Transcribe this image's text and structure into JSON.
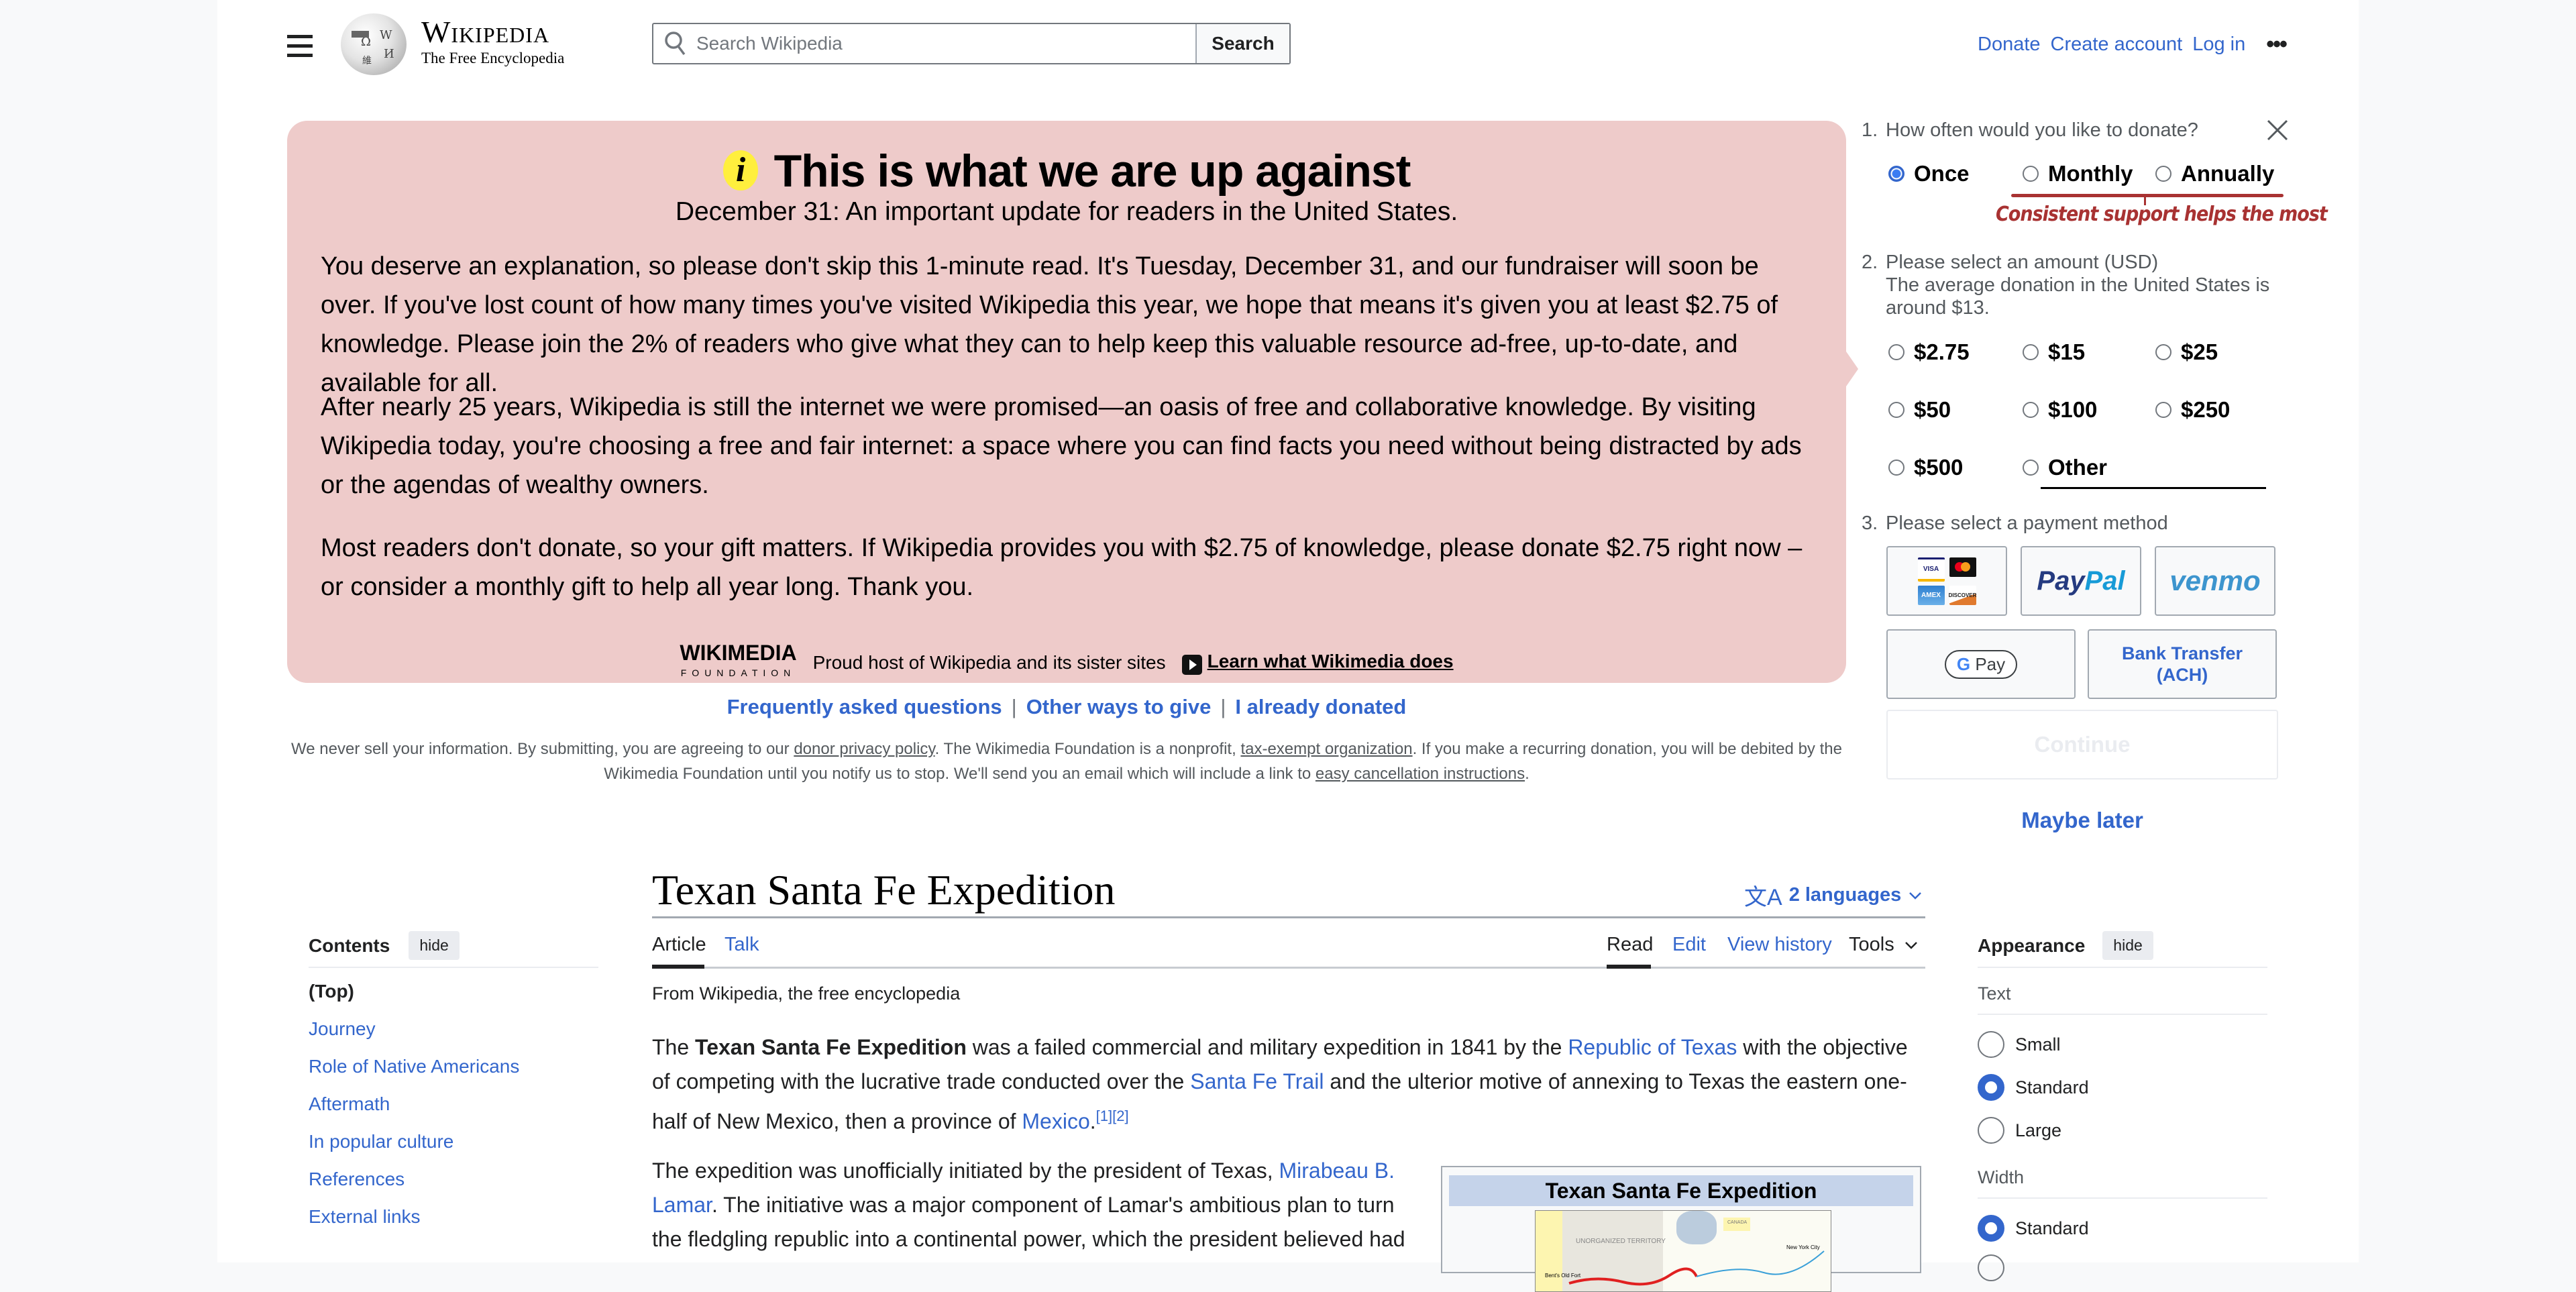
{
  "header": {
    "logo_wordmark": "Wikipedia",
    "logo_tagline": "The Free Encyclopedia",
    "search_placeholder": "Search Wikipedia",
    "search_button": "Search",
    "links": [
      "Donate",
      "Create account",
      "Log in"
    ],
    "more_icon": "ellipsis-icon"
  },
  "banner": {
    "title": "This is what we are up against",
    "subtitle": "December 31: An important update for readers in the United States.",
    "paragraphs": [
      "You deserve an explanation, so please don't skip this 1-minute read. It's Tuesday, December 31, and our fundraiser will soon be over. If you've lost count of how many times you've visited Wikipedia this year, we hope that means it's given you at least $2.75 of knowledge. Please join the 2% of readers who give what they can to help keep this valuable resource ad-free, up-to-date, and available for all.",
      "After nearly 25 years, Wikipedia is still the internet we were promised—an oasis of free and collaborative knowledge. By visiting Wikipedia today, you're choosing a free and fair internet: a space where you can find facts you need without being distracted by ads or the agendas of wealthy owners.",
      "Most readers don't donate, so your gift matters. If Wikipedia provides you with $2.75 of knowledge, please donate $2.75 right now – or consider a monthly gift to help all year long. Thank you."
    ],
    "wmf_logo_top": "WIKIMEDIA",
    "wmf_logo_bottom": "FOUNDATION",
    "proud_text": "Proud host of Wikipedia and its sister sites",
    "learn_link": "Learn what Wikimedia does",
    "bottom_links": [
      "Frequently asked questions",
      "Other ways to give",
      "I already donated"
    ],
    "legal": {
      "part1": "We never sell your information. By submitting, you are agreeing to our ",
      "link1": "donor privacy policy",
      "part2": ". The Wikimedia Foundation is a nonprofit, ",
      "link2": "tax-exempt organization",
      "part3": ". If you make a recurring donation, you will be debited by the Wikimedia Foundation until you notify us to stop. We'll send you an email which will include a link to ",
      "link3": "easy cancellation instructions",
      "part4": "."
    }
  },
  "donation_form": {
    "q1_number": "1.",
    "q1": "How often would you like to donate?",
    "frequency_options": [
      {
        "label": "Once",
        "selected": true
      },
      {
        "label": "Monthly",
        "selected": false
      },
      {
        "label": "Annually",
        "selected": false
      }
    ],
    "frequency_note": "Consistent support helps the most",
    "q2_number": "2.",
    "q2": "Please select an amount (USD)",
    "q2_note": "The average donation in the United States is around $13.",
    "amounts": [
      "$2.75",
      "$15",
      "$25",
      "$50",
      "$100",
      "$250",
      "$500",
      "Other"
    ],
    "q3_number": "3.",
    "q3": "Please select a payment method",
    "payment_methods": {
      "cards": [
        "VISA",
        "mastercard",
        "AMEX",
        "DISCOVER"
      ],
      "paypal_a": "Pay",
      "paypal_b": "Pal",
      "venmo": "venmo",
      "gpay_g": "G",
      "gpay": "Pay",
      "bank_line1": "Bank Transfer",
      "bank_line2": "(ACH)"
    },
    "continue_button": "Continue",
    "maybe_later": "Maybe later"
  },
  "article": {
    "title": "Texan Santa Fe Expedition",
    "languages": "2 languages",
    "tabs_left": [
      "Article",
      "Talk"
    ],
    "tabs_right": [
      "Read",
      "Edit",
      "View history",
      "Tools"
    ],
    "from": "From Wikipedia, the free encyclopedia",
    "p1": {
      "t1": "The ",
      "bold": "Texan Santa Fe Expedition",
      "t2": " was a failed commercial and military expedition in 1841 by the ",
      "l1": "Republic of Texas",
      "t3": " with the objective of competing with the lucrative trade conducted over the ",
      "l2": "Santa Fe Trail",
      "t4": " and the ulterior motive of annexing to Texas the eastern one-half of New Mexico, then a province of ",
      "l3": "Mexico",
      "t5": ".",
      "refs": "[1][2]"
    },
    "p2": {
      "t1": "The expedition was unofficially initiated by the president of Texas, ",
      "l1": "Mirabeau B. Lamar",
      "t2": ". The initiative was a major component of Lamar's ambitious plan to turn the fledgling republic into a continental power, which the president believed had"
    },
    "infobox_title": "Texan Santa Fe Expedition",
    "map_labels": [
      "UNORGANIZED TERRITORY",
      "CANADA",
      "New York City",
      "Bent's Old Fort"
    ]
  },
  "toc": {
    "title": "Contents",
    "hide": "hide",
    "items": [
      "(Top)",
      "Journey",
      "Role of Native Americans",
      "Aftermath",
      "In popular culture",
      "References",
      "External links"
    ]
  },
  "appearance": {
    "title": "Appearance",
    "hide": "hide",
    "text_label": "Text",
    "text_options": [
      {
        "label": "Small",
        "selected": false
      },
      {
        "label": "Standard",
        "selected": true
      },
      {
        "label": "Large",
        "selected": false
      }
    ],
    "width_label": "Width",
    "width_options": [
      {
        "label": "Standard",
        "selected": true
      }
    ]
  }
}
